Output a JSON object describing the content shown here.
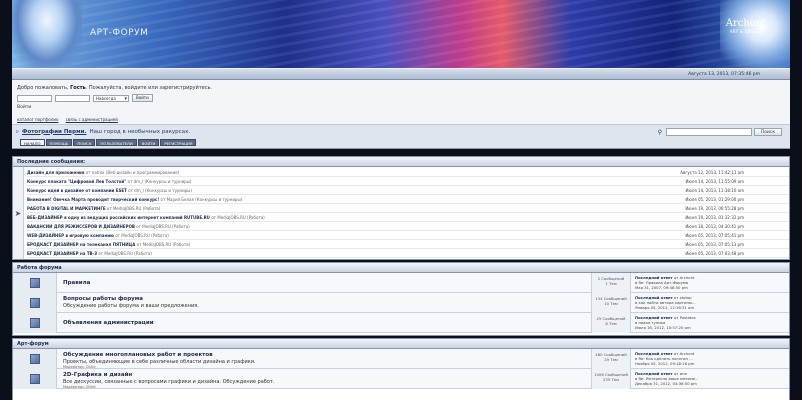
{
  "header": {
    "forum_title": "АРТ-ФОРУМ",
    "logo_main": "Archont",
    "logo_sub": "ART & DESIGN"
  },
  "topbar": {
    "datetime": "Августа 13, 2013, 07:35:46 pm"
  },
  "userbox": {
    "welcome_prefix": "Добро пожаловать,",
    "guest": "Гость",
    "welcome_suffix": ". Пожалуйста, войдите или зарегистрируйтесь.",
    "duration_option": "Навсегда",
    "login_button": "Войти",
    "login_link": "Войти",
    "links": [
      "каталог портфолио",
      "связь с администрацией"
    ]
  },
  "navbar": {
    "title": "Фотографии Перми.",
    "title_rest": "Наш город в необычных ракурсах.",
    "search_button": "Поиск",
    "menu": [
      "НАЧАЛО",
      "ПОМОЩЬ",
      "ПОИСК",
      "ПОЛЬЗОВАТЕЛИ",
      "ВОЙТИ",
      "РЕГИСТРАЦИЯ"
    ]
  },
  "recent": {
    "heading": "Последние сообщения:",
    "items": [
      {
        "title": "Дизайн для приложения",
        "meta": "от natrox (Веб-дизайн и программирование)",
        "date": "Августа 12, 2013, 11:42:11 am"
      },
      {
        "title": "Конкурс плаката \"Цифровой Лев Толстой\"",
        "meta": "от dm_l (Конкурсы и турниры)",
        "date": "Июля 14, 2013, 11:55:09 am"
      },
      {
        "title": "Конкурс идей в дизайне от компании ESET",
        "meta": "от dm_l (Конкурсы и турниры)",
        "date": "Июля 14, 2013, 11:38:10 am"
      },
      {
        "title": "Внимание! Овечка Марта проводит творческий конкурс!",
        "meta": "от Мария Белая (Конкурсы и турниры)",
        "date": "Июля 05, 2013, 01:29:00 pm"
      },
      {
        "title": "РАБОТА В DIGITAL И МАРКЕТИНГЕ",
        "meta": "от MediaJOBS.RU (Работа)",
        "date": "Июня 19, 2013, 06:55:28 pm"
      },
      {
        "title": "ВЕБ-ДИЗАЙНЕР в одну из ведущих российских интернет компаний RUTUBE.RU",
        "meta": "от MediaJOBS.RU (Работа)",
        "date": "Июня 19, 2013, 01:32:32 pm"
      },
      {
        "title": "ВАКАНСИИ ДЛЯ РЕЖИССЕРОВ И ДИЗАЙНЕРОВ",
        "meta": "от MediaJOBS.RU (Работа)",
        "date": "Июня 18, 2013, 04:30:41 pm"
      },
      {
        "title": "WEB-ДИЗАЙНЕР в игровую компанию",
        "meta": "от MediaJOBS.RU (Работа)",
        "date": "Июня 05, 2013, 07:05:41 pm"
      },
      {
        "title": "БРОДКАСТ ДИЗАЙНЕР на телеканал ПЯТНИЦА",
        "meta": "от MediaJOBS.RU (Работа)",
        "date": "Июня 05, 2013, 07:05:13 pm"
      },
      {
        "title": "БРОДКАСТ ДИЗАЙНЕР на ТВ-3",
        "meta": "от MediaJOBS.RU (Работа)",
        "date": "Июня 05, 2013, 07:03:48 pm"
      }
    ]
  },
  "section_work": {
    "heading": "Работа форума",
    "forums": [
      {
        "title": "Правила",
        "desc": "",
        "mod": "",
        "posts": "2 Сообщений",
        "topics": "1 Тем",
        "last_label": "Последний ответ",
        "last_by": "от Archont",
        "last_in": "в Re: Правила Арт-Форума",
        "last_date": "Мая 31, 2007, 09:48:50 pm"
      },
      {
        "title": "Вопросы работы форума",
        "desc": "Обсуждение работы форума и ваши предложения.",
        "mod": "",
        "posts": "134 Сообщений",
        "topics": "10 Тем",
        "last_label": "Последний ответ",
        "last_by": "от stotop",
        "last_in": "в как найти автора картины...",
        "last_date": "Января 05, 2012, 12:16:31 am"
      },
      {
        "title": "Объявления администрации",
        "desc": "",
        "mod": "",
        "posts": "25 Сообщений",
        "topics": "8 Тем",
        "last_label": "Последний ответ",
        "last_by": "от Pastatos",
        "last_in": "в новая тупика",
        "last_date": "Июля 16, 2012, 10:57:20 pm"
      }
    ]
  },
  "section_art": {
    "heading": "Арт-форум",
    "forums": [
      {
        "title": "Обсуждение многоплановых работ и проектов",
        "desc": "Проекты, объединяющие в себе различные области дизайна и графики.",
        "mod": "Модератор: OliArt",
        "posts": "460 Сообщений",
        "topics": "29 Тем",
        "last_label": "Последний ответ",
        "last_by": "от Archont",
        "last_in": "в Re: Как сделать логотип ...",
        "last_date": "Ноября 05, 2012, 09:18:16 pm"
      },
      {
        "title": "2D-Графика и дизайн",
        "desc": "Все дискуссии, связанные с вопросами графики и дизайна. Обсуждение работ.",
        "mod": "Модератор: OliArt",
        "posts": "1406 Сообщений",
        "topics": "235 Тем",
        "last_label": "Последний ответ",
        "last_by": "от ипп",
        "last_in": "в Re: Интересно ваше мнение...",
        "last_date": "Декабря 31, 2012, 04:36:50 pm"
      }
    ]
  }
}
